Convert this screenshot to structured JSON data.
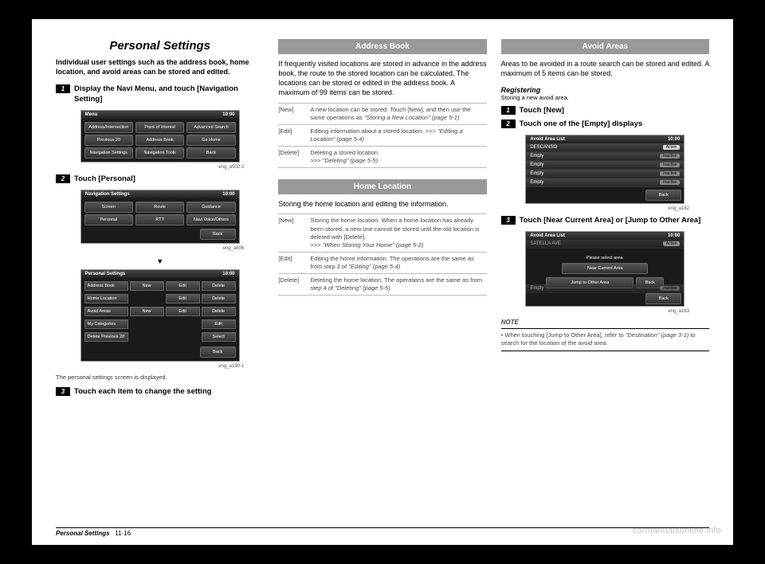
{
  "col1": {
    "title": "Personal Settings",
    "intro": "Individual user settings such as the address book, home location, and avoid areas can be stored and edited.",
    "step1": {
      "num": "1",
      "text": "Display the Navi Menu, and touch [Navigation Setting]"
    },
    "shot1": {
      "title": "Menu",
      "time": "10:00",
      "r1a": "Address/Intersection",
      "r1b": "Point of Interest",
      "r1c": "Advanced Search",
      "r2a": "Previous 20",
      "r2b": "Address Book",
      "r2c": "Go Home",
      "r3a": "Navigation Settings",
      "r3b": "Navigation Tools",
      "r3c": "Back",
      "cap": "eng_a502-2"
    },
    "step2": {
      "num": "2",
      "text": "Touch [Personal]"
    },
    "shot2": {
      "title": "Navigation Settings",
      "time": "10:00",
      "r1a": "Screen",
      "r1b": "Route",
      "r1c": "Guidance",
      "r2a": "Personal",
      "r2b": "RTT",
      "r2c": "Navi Voice/Others",
      "back": "Back",
      "cap": "eng_a606"
    },
    "shot3": {
      "title": "Personal Settings",
      "time": "10:00",
      "rows": [
        {
          "label": "Address Book",
          "c1": "New",
          "c2": "Edit",
          "c3": "Delete"
        },
        {
          "label": "Home Location",
          "c1": "",
          "c2": "Edit",
          "c3": "Delete"
        },
        {
          "label": "Avoid Areas",
          "c1": "New",
          "c2": "Edit",
          "c3": "Delete"
        },
        {
          "label": "My Categories",
          "c1": "",
          "c2": "",
          "c3": "Edit"
        },
        {
          "label": "Delete Previous 20",
          "c1": "",
          "c2": "",
          "c3": "Select"
        }
      ],
      "back": "Back",
      "cap": "eng_a190-1"
    },
    "after_shot3": "The personal settings screen is displayed.",
    "step3": {
      "num": "3",
      "text": "Touch each item to change the setting"
    }
  },
  "col2": {
    "address_book": {
      "title": "Address Book",
      "body": "If frequently visited locations are stored in advance in the address book, the route to the stored location can be calculated. The locations can be stored or edited in the address book. A maximum of 99 items can be stored.",
      "rows": [
        {
          "k": "[New]",
          "v": "A new location can be stored. Touch [New], and then use the same operations as ",
          "em": "\"Storing a New Location\" (page 5-1)"
        },
        {
          "k": "[Edit]",
          "v": "Editing information about a stored location. >>> ",
          "em": "\"Editing a Location\" (page 5-4)"
        },
        {
          "k": "[Delete]",
          "v": "Deleting a stored location.\n>>> ",
          "em": "\"Deleting\" (page 5-5)"
        }
      ]
    },
    "home": {
      "title": "Home Location",
      "body": "Storing the home location and editing the information.",
      "rows": [
        {
          "k": "[New]",
          "v": "Storing the home location. When a home location has already been stored, a new one cannot be stored until the old location is deleted with [Delete].\n>>> ",
          "em": "\"When Storing Your Home\" (page 5-2)"
        },
        {
          "k": "[Edit]",
          "v": "Editing the home information. The operations are the same as from step 3 of ",
          "em": "\"Editing\" (page 5-4)"
        },
        {
          "k": "[Delete]",
          "v": "Deleting the home location. The operations are the same as from step 4 of ",
          "em": "\"Deleting\" (page 5-5)"
        }
      ]
    }
  },
  "col3": {
    "avoid": {
      "title": "Avoid Areas",
      "body": "Areas to be avoided in a route search can be stored and edited. A maximum of 5 items can be stored.",
      "registering": "Registering",
      "reg_sub": "Storing a new avoid area.",
      "step1": {
        "num": "1",
        "text": "Touch [New]"
      },
      "step2": {
        "num": "2",
        "text": "Touch one of the [Empty] displays"
      },
      "shot1": {
        "title": "Avoid Area List",
        "time": "10:00",
        "rows": [
          {
            "label": "DESCANSO",
            "status": "Active",
            "active": true
          },
          {
            "label": "Empty",
            "status": "Inactive"
          },
          {
            "label": "Empty",
            "status": "Inactive"
          },
          {
            "label": "Empty",
            "status": "Inactive"
          },
          {
            "label": "Empty",
            "status": "Inactive"
          }
        ],
        "back": "Back",
        "cap": "eng_a182"
      },
      "step3": {
        "num": "3",
        "text": "Touch [Near Current Area] or [Jump to Other Area]"
      },
      "shot2": {
        "title": "Avoid Area List",
        "time": "10:00",
        "row1": "SATELLA AVE",
        "row1s": "Active",
        "prompt": "Please select area.",
        "b1": "Near Current Area",
        "b2": "Jump to Other Area",
        "b3": "Back",
        "row_empty": "Empty",
        "row_empty_s": "Inactive",
        "back": "Back",
        "cap": "eng_a183"
      },
      "note_title": "NOTE",
      "note_item": "When touching [Jump to Other Area], refer to ",
      "note_em": "\"Destination\" (page 3-1)",
      "note_tail": " to search for the location of the avoid area."
    }
  },
  "footer": {
    "title": "Personal Settings",
    "page": "11-16"
  },
  "watermark": "carmanualsonline.info"
}
